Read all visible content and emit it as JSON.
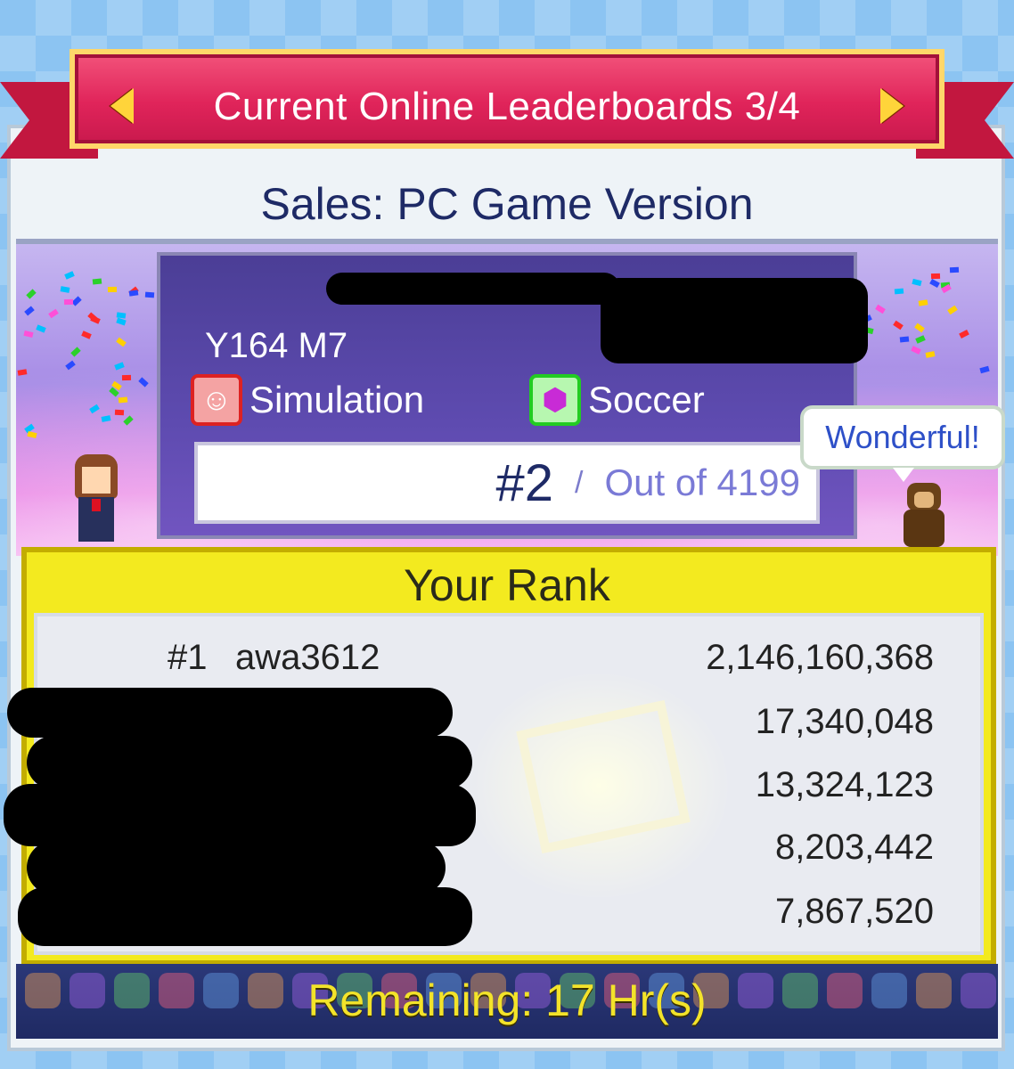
{
  "header": {
    "title": "Current Online Leaderboards 3/4",
    "prev_icon": "arrow-left-icon",
    "next_icon": "arrow-right-icon"
  },
  "board": {
    "title": "Sales: PC Game Version",
    "date": "Y164 M7",
    "genre": "Simulation",
    "type": "Soccer",
    "rank": "#2",
    "slash": "/",
    "out_of": "Out of 4199",
    "bubble": "Wonderful!"
  },
  "leaderboard": {
    "heading": "Your Rank",
    "rows": [
      {
        "rank": "#1",
        "name": "awa3612",
        "score": "2,146,160,368"
      },
      {
        "rank": "",
        "name": "",
        "score": "17,340,048"
      },
      {
        "rank": "",
        "name": "",
        "score": "13,324,123"
      },
      {
        "rank": "",
        "name": "",
        "score": "8,203,442"
      },
      {
        "rank": "",
        "name": "",
        "score": "7,867,520"
      }
    ]
  },
  "footer": {
    "remaining": "Remaining: 17 Hr(s)"
  },
  "colors": {
    "ribbon": "#e0245a",
    "title_text": "#1e2a66",
    "rank_panel": "#f3ea1f",
    "remaining_text": "#f3e32a"
  }
}
